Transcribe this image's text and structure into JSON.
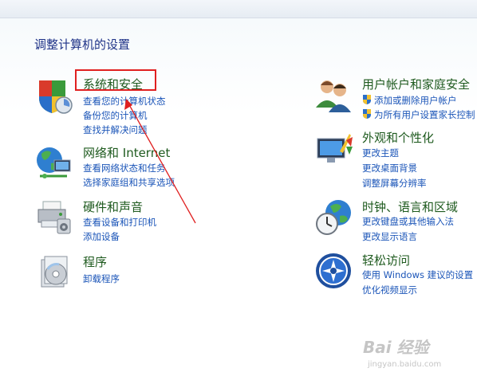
{
  "page": {
    "title": "调整计算机的设置"
  },
  "left_categories": [
    {
      "title": "系统和安全",
      "icon": "shield-icon",
      "links": [
        "查看您的计算机状态",
        "备份您的计算机",
        "查找并解决问题"
      ]
    },
    {
      "title": "网络和 Internet",
      "icon": "network-globe-icon",
      "links": [
        "查看网络状态和任务",
        "选择家庭组和共享选项"
      ]
    },
    {
      "title": "硬件和声音",
      "icon": "printer-icon",
      "links": [
        "查看设备和打印机",
        "添加设备"
      ]
    },
    {
      "title": "程序",
      "icon": "programs-disc-icon",
      "links": [
        "卸载程序"
      ]
    }
  ],
  "right_categories": [
    {
      "title": "用户帐户和家庭安全",
      "icon": "users-icon",
      "links": [
        "添加或删除用户帐户",
        "为所有用户设置家长控制"
      ],
      "link_icons": [
        "uac-shield-icon",
        "uac-shield-icon"
      ]
    },
    {
      "title": "外观和个性化",
      "icon": "appearance-monitor-icon",
      "links": [
        "更改主题",
        "更改桌面背景",
        "调整屏幕分辨率"
      ]
    },
    {
      "title": "时钟、语言和区域",
      "icon": "clock-globe-icon",
      "links": [
        "更改键盘或其他输入法",
        "更改显示语言"
      ]
    },
    {
      "title": "轻松访问",
      "icon": "ease-of-access-icon",
      "links": [
        "使用 Windows 建议的设置",
        "优化视频显示"
      ]
    }
  ],
  "watermark": {
    "logo": "Bai 经验",
    "url": "jingyan.baidu.com"
  },
  "colors": {
    "category_title": "#1e5a1e",
    "link": "#1b55b8",
    "page_title": "#1e3287",
    "annotation": "#e02020"
  }
}
